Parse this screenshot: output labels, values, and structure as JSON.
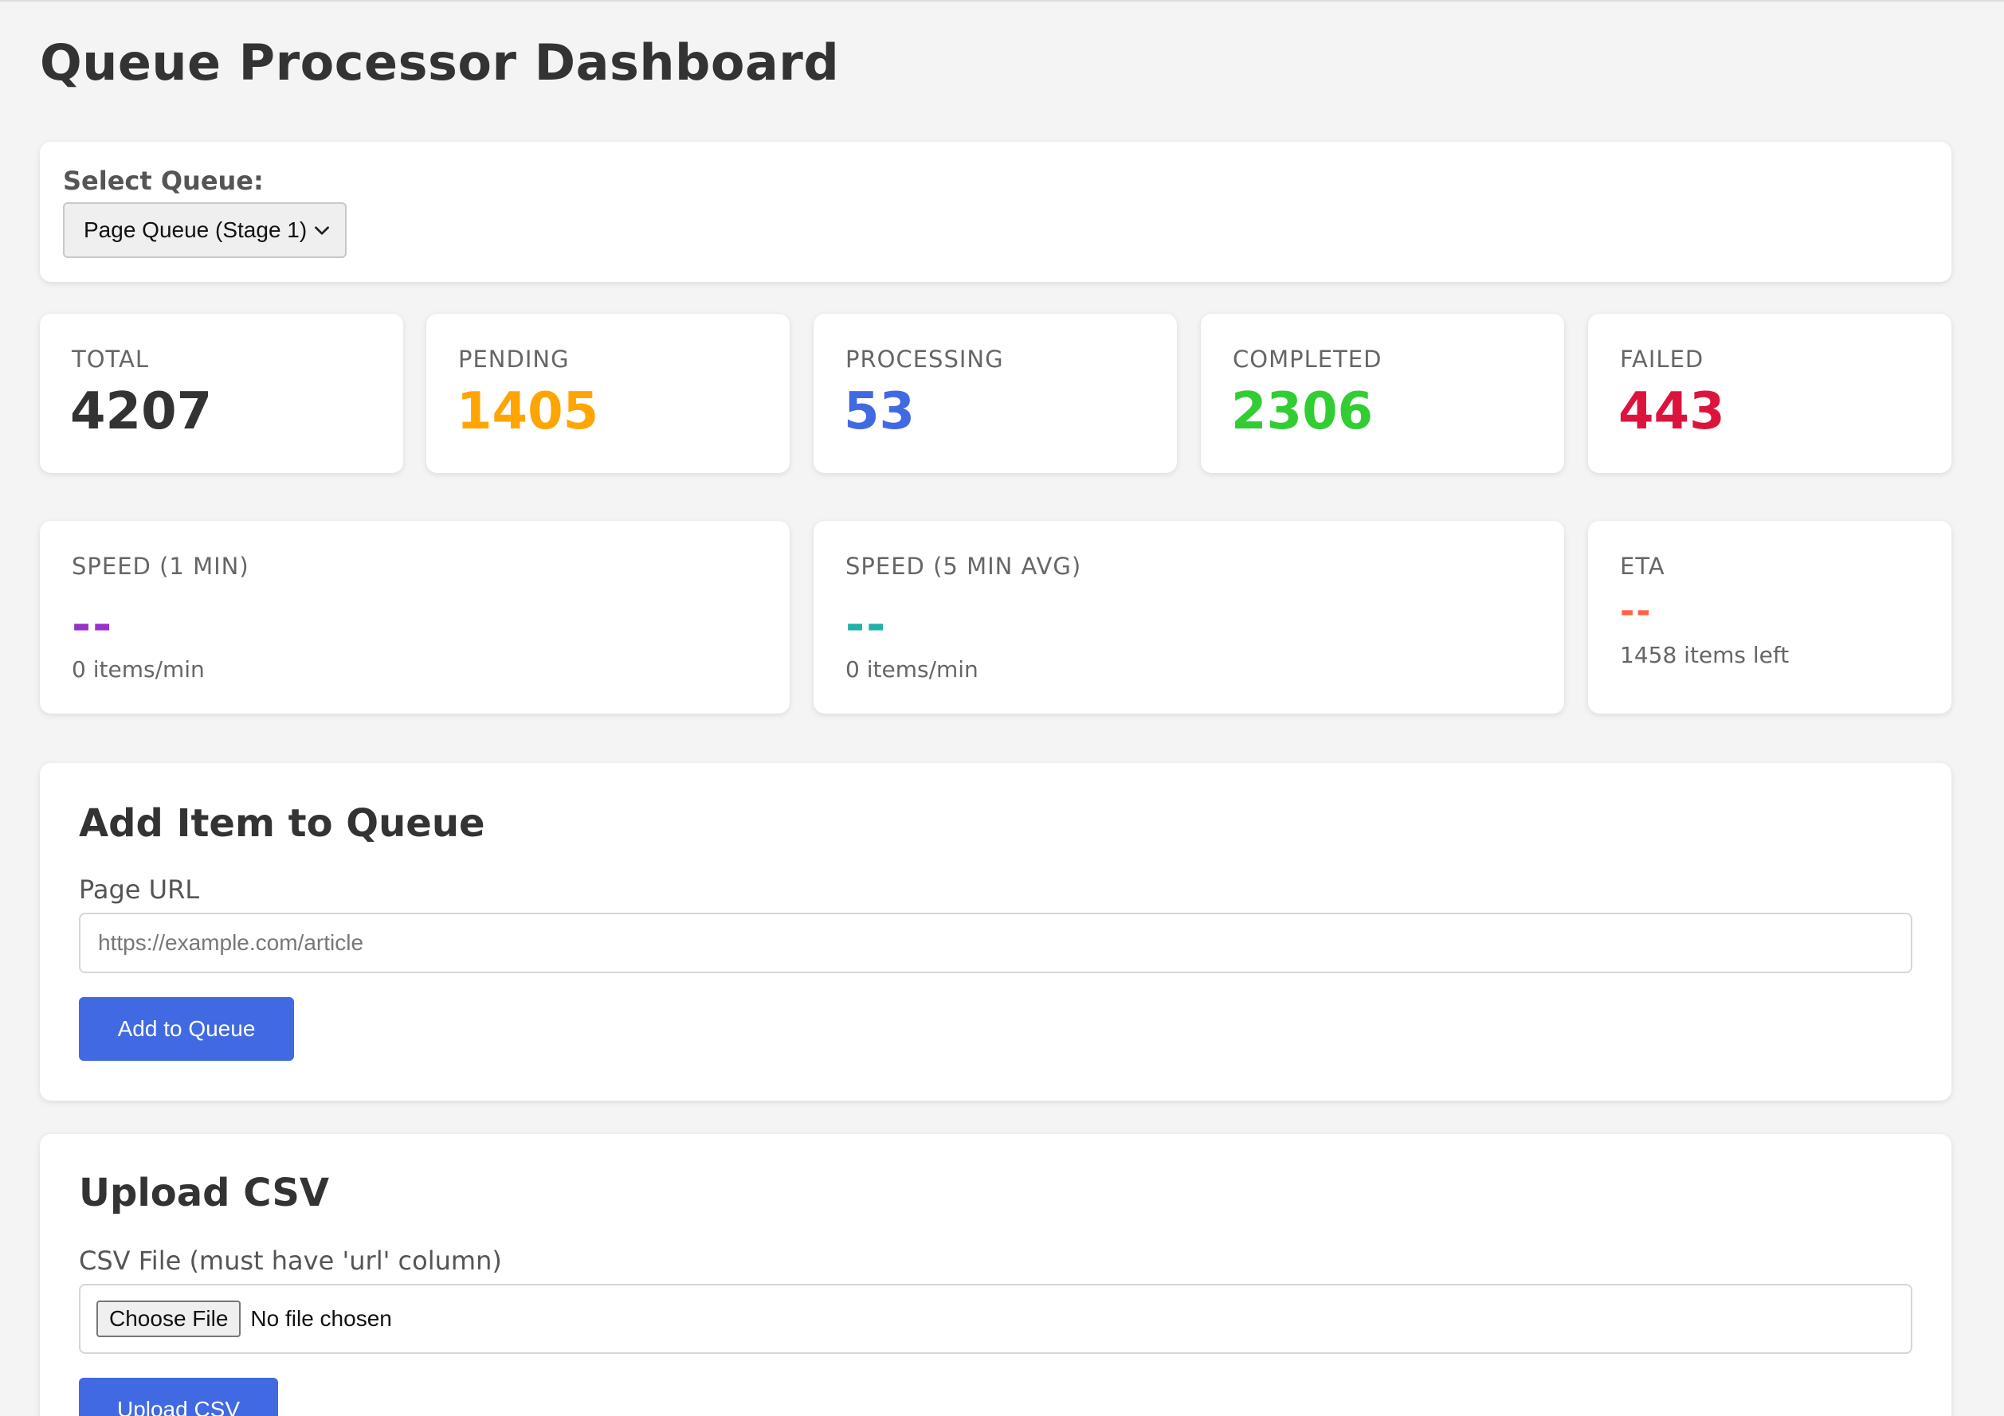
{
  "page": {
    "title": "Queue Processor Dashboard"
  },
  "queue_selector": {
    "label": "Select Queue:",
    "selected": "Page Queue (Stage 1)"
  },
  "stats": [
    {
      "label": "TOTAL",
      "value": "4207",
      "color": "#333333"
    },
    {
      "label": "PENDING",
      "value": "1405",
      "color": "#ffa500"
    },
    {
      "label": "PROCESSING",
      "value": "53",
      "color": "#4169e1"
    },
    {
      "label": "COMPLETED",
      "value": "2306",
      "color": "#32cd32"
    },
    {
      "label": "FAILED",
      "value": "443",
      "color": "#dc143c"
    }
  ],
  "speed": {
    "one_min": {
      "label": "SPEED (1 MIN)",
      "value": "--",
      "sub": "0 items/min",
      "color": "#9932cc"
    },
    "five_min": {
      "label": "SPEED (5 MIN AVG)",
      "value": "--",
      "sub": "0 items/min",
      "color": "#20b2aa"
    },
    "eta": {
      "label": "ETA",
      "value": "--",
      "sub": "1458 items left",
      "color": "#ff6347"
    }
  },
  "add_item": {
    "heading": "Add Item to Queue",
    "field_label": "Page URL",
    "placeholder": "https://example.com/article",
    "button": "Add to Queue"
  },
  "upload_csv": {
    "heading": "Upload CSV",
    "field_label": "CSV File (must have 'url' column)",
    "choose_button": "Choose File",
    "no_file": "No file chosen",
    "button": "Upload CSV"
  },
  "colors": {
    "accent": "#4169e1",
    "background": "#f4f4f4"
  }
}
